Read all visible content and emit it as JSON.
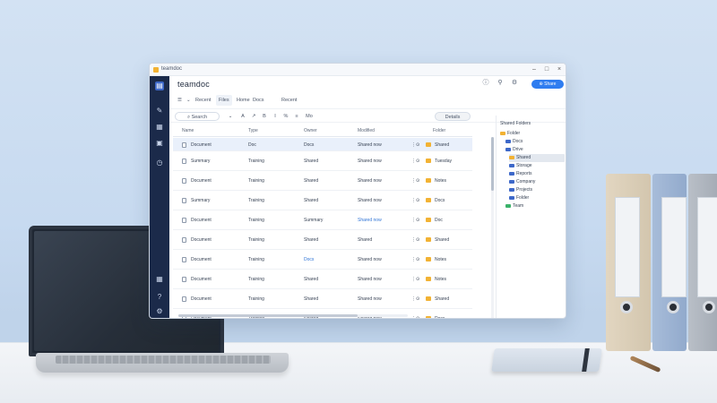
{
  "window": {
    "title": "teamdoc",
    "controls": {
      "minimize": "–",
      "maximize": "□",
      "close": "×"
    }
  },
  "topbar": {
    "workspace": "teamdoc",
    "share_label": "⊕ Share"
  },
  "navbar": {
    "items": [
      {
        "label": "☰"
      },
      {
        "label": "⌄"
      },
      {
        "label": "Recent"
      },
      {
        "label": "Files"
      },
      {
        "label": "Home"
      },
      {
        "label": "Docs"
      },
      {
        "label": "Recent"
      }
    ]
  },
  "toolbar": {
    "search_label": "Search",
    "tools": [
      "A",
      "↗",
      "B",
      "I",
      "%",
      "≡",
      "Mo"
    ],
    "details_label": "Details"
  },
  "table": {
    "columns": [
      "Name",
      "Type",
      "Owner",
      "Modified",
      "Folder"
    ],
    "rows": [
      {
        "name": "Document",
        "type": "Doc",
        "owner": "Docs",
        "modified": "Shared now",
        "folder": "Shared"
      },
      {
        "name": "Summary",
        "type": "Training",
        "owner": "Shared",
        "modified": "Shared now",
        "folder": "Tuesday"
      },
      {
        "name": "Document",
        "type": "Training",
        "owner": "Shared",
        "modified": "Shared now",
        "folder": "Notes"
      },
      {
        "name": "Summary",
        "type": "Training",
        "owner": "Shared",
        "modified": "Shared now",
        "folder": "Docs"
      },
      {
        "name": "Document",
        "type": "Training",
        "owner": "Summary",
        "modified": "Shared now",
        "folder": "Doc"
      },
      {
        "name": "Document",
        "type": "Training",
        "owner": "Shared",
        "modified": "Shared",
        "folder": "Shared"
      },
      {
        "name": "Document",
        "type": "Training",
        "owner": "Docs",
        "modified": "Shared now",
        "folder": "Notes"
      },
      {
        "name": "Document",
        "type": "Training",
        "owner": "Shared",
        "modified": "Shared now",
        "folder": "Notes"
      },
      {
        "name": "Document",
        "type": "Training",
        "owner": "Shared",
        "modified": "Shared now",
        "folder": "Shared"
      },
      {
        "name": "Document",
        "type": "Training",
        "owner": "Shared",
        "modified": "Shared now",
        "folder": "Docs"
      }
    ]
  },
  "tree": {
    "header": "Shared Folders",
    "nodes": [
      {
        "label": "Folder",
        "color": "#f2b233"
      },
      {
        "label": "Docs",
        "color": "#3d68c9"
      },
      {
        "label": "Drive",
        "color": "#3d68c9"
      },
      {
        "label": "Shared",
        "color": "#f2b233"
      },
      {
        "label": "Storage",
        "color": "#3d68c9"
      },
      {
        "label": "Reports",
        "color": "#3d68c9"
      },
      {
        "label": "Company",
        "color": "#3d68c9"
      },
      {
        "label": "Projects",
        "color": "#3d68c9"
      },
      {
        "label": "Folder",
        "color": "#3d68c9"
      },
      {
        "label": "Team",
        "color": "#3bb26a"
      }
    ]
  },
  "colors": {
    "accent": "#2f7df0",
    "sidebar": "#1b2a4a",
    "folder": "#f2b233"
  }
}
